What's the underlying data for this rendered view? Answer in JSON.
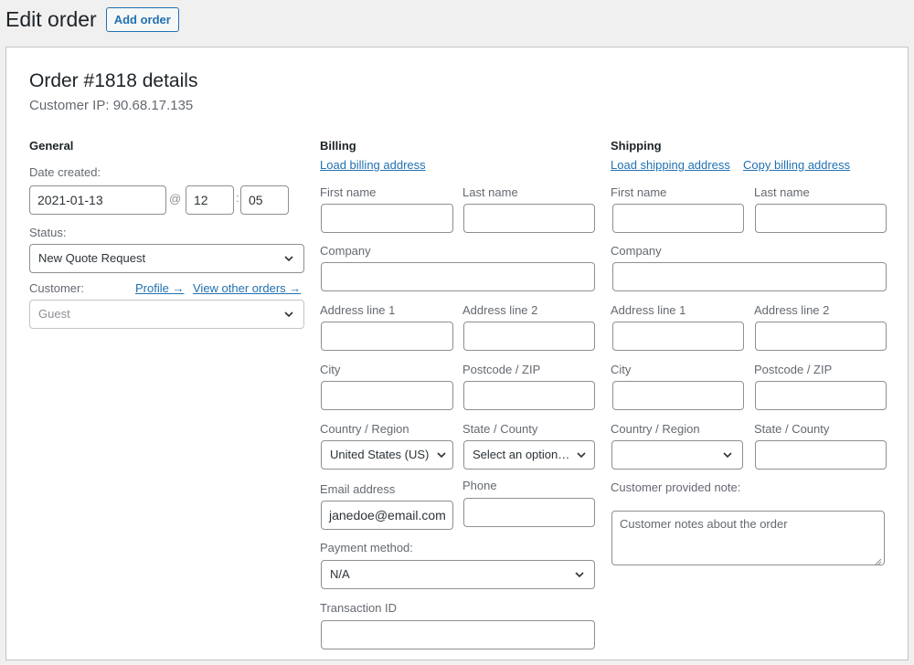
{
  "header": {
    "title": "Edit order",
    "add_order_label": "Add order"
  },
  "order": {
    "title": "Order #1818 details",
    "customer_ip": "Customer IP: 90.68.17.135"
  },
  "general": {
    "title": "General",
    "date_label": "Date created:",
    "date_value": "2021-01-13",
    "at_sep": "@",
    "colon_sep": ":",
    "hour": "12",
    "minute": "05",
    "status_label": "Status:",
    "status_value": "New Quote Request",
    "customer_label": "Customer:",
    "profile_link": "Profile →",
    "other_orders_link": "View other orders →",
    "customer_value": "Guest"
  },
  "billing": {
    "title": "Billing",
    "load_link": "Load billing address",
    "first_name_label": "First name",
    "last_name_label": "Last name",
    "company_label": "Company",
    "address1_label": "Address line 1",
    "address2_label": "Address line 2",
    "city_label": "City",
    "postcode_label": "Postcode / ZIP",
    "country_label": "Country / Region",
    "country_value": "United States (US)",
    "state_label": "State / County",
    "state_value": "Select an option…",
    "email_label": "Email address",
    "email_value": "janedoe@email.com",
    "phone_label": "Phone",
    "payment_label": "Payment method:",
    "payment_value": "N/A",
    "transaction_label": "Transaction ID"
  },
  "shipping": {
    "title": "Shipping",
    "load_link": "Load shipping address",
    "copy_link": "Copy billing address",
    "first_name_label": "First name",
    "last_name_label": "Last name",
    "company_label": "Company",
    "address1_label": "Address line 1",
    "address2_label": "Address line 2",
    "city_label": "City",
    "postcode_label": "Postcode / ZIP",
    "country_label": "Country / Region",
    "state_label": "State / County",
    "note_label": "Customer provided note:",
    "note_placeholder": "Customer notes about the order"
  },
  "icons": {
    "dropdown": "chevron-down-icon",
    "resize": "resize-grip-icon"
  },
  "colors": {
    "link": "#2271b1",
    "border": "#8c8f94",
    "background": "#f0f0f1"
  }
}
